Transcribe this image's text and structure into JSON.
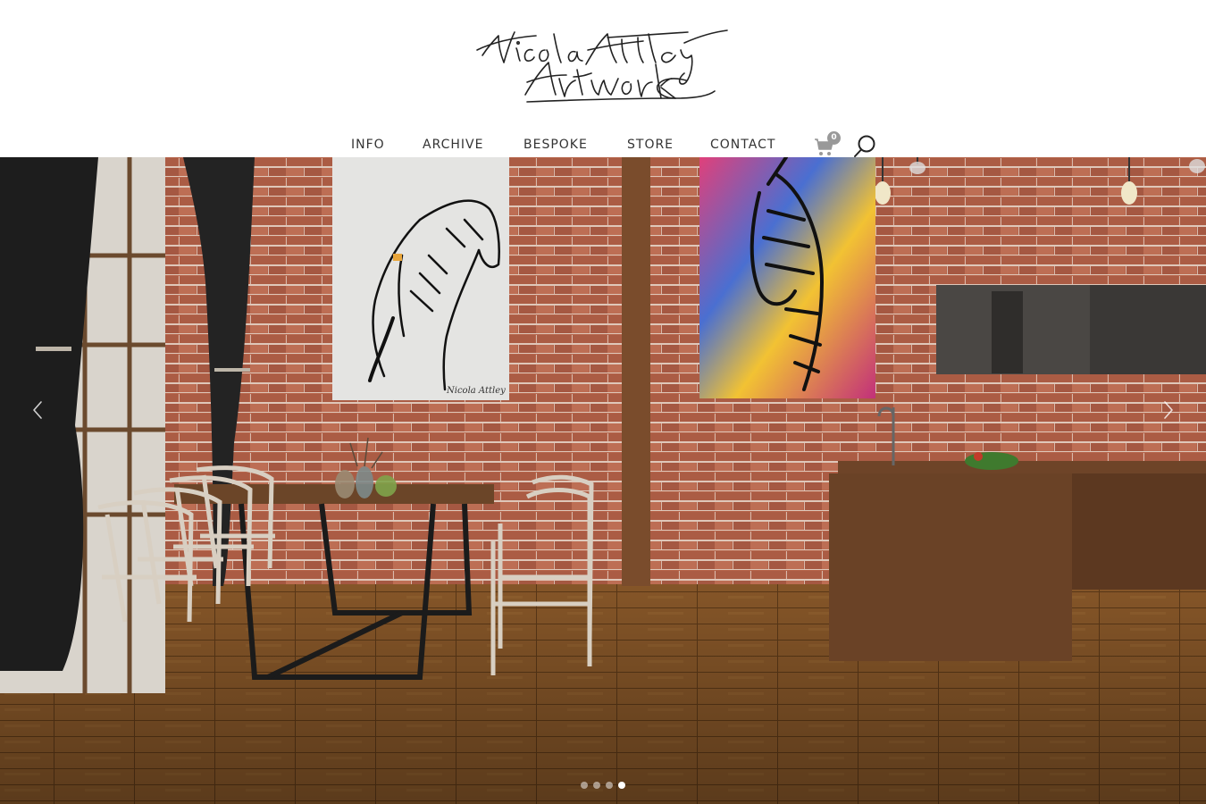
{
  "brand": {
    "logo_text_line1": "Nicola Attley",
    "logo_text_line2": "Artwork"
  },
  "nav": {
    "items": [
      {
        "label": "INFO"
      },
      {
        "label": "ARCHIVE"
      },
      {
        "label": "BESPOKE"
      },
      {
        "label": "STORE"
      },
      {
        "label": "CONTACT"
      }
    ],
    "cart_icon": "shopping-cart-icon",
    "cart_count": "0",
    "search_icon": "search-icon"
  },
  "hero": {
    "prev_icon": "chevron-left-icon",
    "next_icon": "chevron-right-icon",
    "slide_count": 4,
    "active_slide": 4,
    "painting_signature": "Nicola Attley"
  },
  "colors": {
    "nav_text": "#333333",
    "cart_badge": "#999999",
    "brick": "#a8543a",
    "floor": "#8a5a2c"
  }
}
